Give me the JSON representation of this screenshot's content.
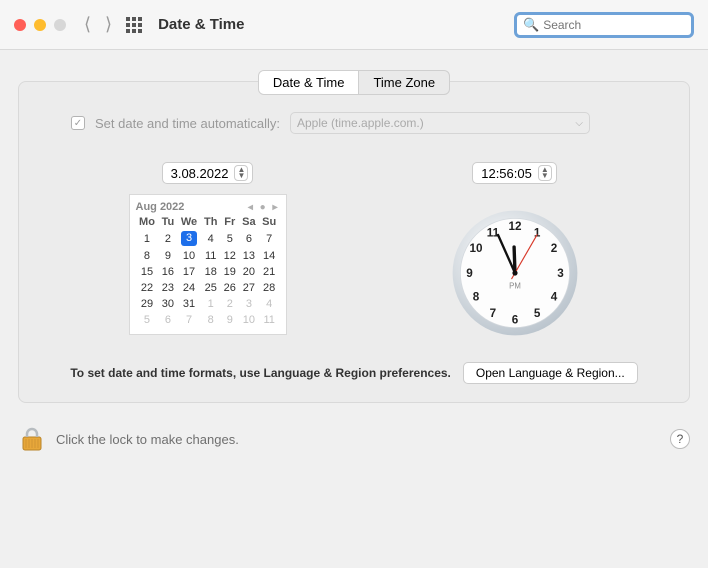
{
  "window": {
    "title": "Date & Time"
  },
  "search": {
    "placeholder": "Search"
  },
  "tabs": {
    "date_time": "Date & Time",
    "time_zone": "Time Zone"
  },
  "auto": {
    "label": "Set date and time automatically:",
    "server": "Apple (time.apple.com.)",
    "checked": true
  },
  "date": {
    "value": "3.08.2022",
    "month_label": "Aug 2022",
    "weekdays": [
      "Mo",
      "Tu",
      "We",
      "Th",
      "Fr",
      "Sa",
      "Su"
    ],
    "weeks": [
      [
        {
          "d": "1"
        },
        {
          "d": "2"
        },
        {
          "d": "3",
          "sel": true
        },
        {
          "d": "4"
        },
        {
          "d": "5"
        },
        {
          "d": "6"
        },
        {
          "d": "7"
        }
      ],
      [
        {
          "d": "8"
        },
        {
          "d": "9"
        },
        {
          "d": "10"
        },
        {
          "d": "11"
        },
        {
          "d": "12"
        },
        {
          "d": "13"
        },
        {
          "d": "14"
        }
      ],
      [
        {
          "d": "15"
        },
        {
          "d": "16"
        },
        {
          "d": "17"
        },
        {
          "d": "18"
        },
        {
          "d": "19"
        },
        {
          "d": "20"
        },
        {
          "d": "21"
        }
      ],
      [
        {
          "d": "22"
        },
        {
          "d": "23"
        },
        {
          "d": "24"
        },
        {
          "d": "25"
        },
        {
          "d": "26"
        },
        {
          "d": "27"
        },
        {
          "d": "28"
        }
      ],
      [
        {
          "d": "29"
        },
        {
          "d": "30"
        },
        {
          "d": "31"
        },
        {
          "d": "1",
          "m": true
        },
        {
          "d": "2",
          "m": true
        },
        {
          "d": "3",
          "m": true
        },
        {
          "d": "4",
          "m": true
        }
      ],
      [
        {
          "d": "5",
          "m": true
        },
        {
          "d": "6",
          "m": true
        },
        {
          "d": "7",
          "m": true
        },
        {
          "d": "8",
          "m": true
        },
        {
          "d": "9",
          "m": true
        },
        {
          "d": "10",
          "m": true
        },
        {
          "d": "11",
          "m": true
        }
      ]
    ]
  },
  "time": {
    "value": "12:56:05",
    "meridiem": "PM",
    "hour_angle": 358,
    "minute_angle": 336,
    "second_angle": 30
  },
  "footer": {
    "text": "To set date and time formats, use Language & Region preferences.",
    "button": "Open Language & Region..."
  },
  "lock": {
    "text": "Click the lock to make changes."
  }
}
